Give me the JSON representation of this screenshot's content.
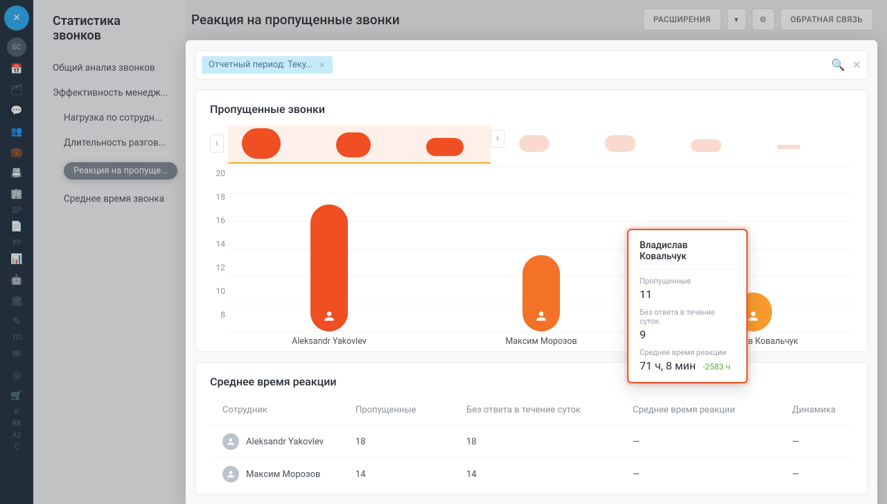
{
  "rail": {
    "avatar_text": "БС",
    "text_items": [
      "ДР",
      "УР",
      "ТП",
      "К",
      "ВВ",
      "АЗ",
      "С"
    ]
  },
  "sidebar": {
    "title": "Статистика звонков",
    "items": [
      {
        "label": "Общий анализ звонков"
      },
      {
        "label": "Эффективность менедж..."
      },
      {
        "label": "Нагрузка по сотрудн..."
      },
      {
        "label": "Длительность разгов..."
      },
      {
        "label": "Реакция на пропуще..."
      },
      {
        "label": "Среднее время звонка"
      }
    ]
  },
  "header": {
    "title": "Реакция на пропущенные звонки",
    "ext_label": "РАСШИРЕНИЯ",
    "feedback_label": "ОБРАТНАЯ СВЯЗЬ"
  },
  "filter": {
    "chip_label": "Отчетный период: Теку..."
  },
  "chart": {
    "title": "Пропущенные звонки"
  },
  "chart_data": {
    "type": "bar",
    "ylabel": "",
    "ylim": [
      8,
      20
    ],
    "y_ticks": [
      20,
      18,
      16,
      14,
      12,
      10,
      8
    ],
    "series": [
      {
        "name": "Aleksandr Yakovlev",
        "value": 18,
        "color": "#f04e23"
      },
      {
        "name": "Максим Морозов",
        "value": 14,
        "color": "#f47228"
      },
      {
        "name": "Владислав Ковальчук",
        "value": 11,
        "color": "#f79b2e"
      }
    ]
  },
  "tooltip": {
    "name": "Владислав Ковальчук",
    "label_missed": "Пропущенные",
    "val_missed": "11",
    "label_noreply": "Без ответа в течение суток",
    "val_noreply": "9",
    "label_avg": "Среднее время реакции",
    "val_avg": "71 ч, 8 мин",
    "delta": "-2583 ч"
  },
  "table": {
    "title": "Среднее время реакции",
    "cols": [
      "Сотрудник",
      "Пропущенные",
      "Без ответа в течение суток",
      "Среднее время реакции",
      "Динамика"
    ],
    "rows": [
      {
        "name": "Aleksandr Yakovlev",
        "missed": "18",
        "noreply": "18",
        "avg": "—",
        "dyn": "—"
      },
      {
        "name": "Максим Морозов",
        "missed": "14",
        "noreply": "14",
        "avg": "—",
        "dyn": "—"
      }
    ]
  }
}
